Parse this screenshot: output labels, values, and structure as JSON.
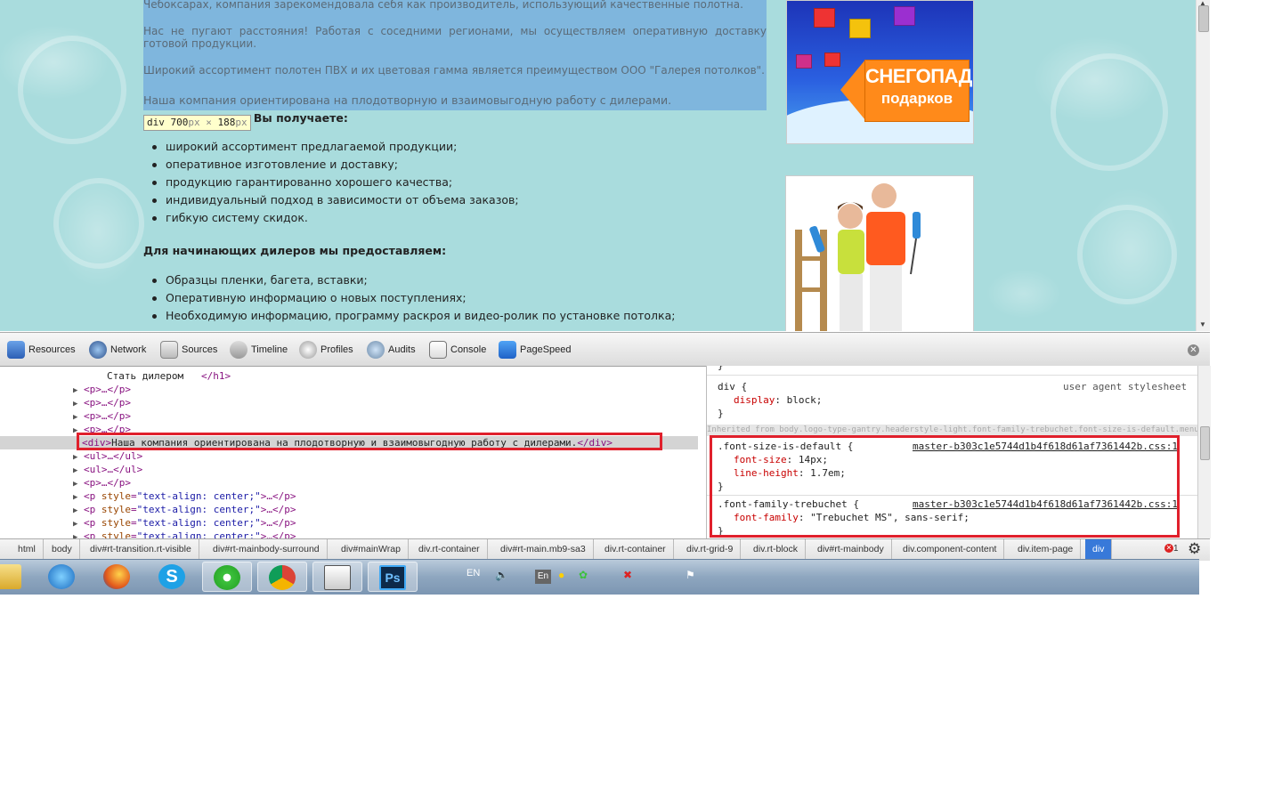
{
  "page": {
    "paragraphs": [
      "Чебоксарах, компания зарекомендовала себя как производитель, использующий качественные полотна.",
      "Нас не пугают расстояния! Работая с соседними регионами, мы осуществляем оперативную доставку готовой продукции.",
      "Широкий ассортимент полотен ПВХ и их цветовая гамма является преимуществом ООО \"Галерея потолков\".",
      "Наша компания ориентирована на плодотворную и взаимовыгодную работу с дилерами."
    ],
    "dims_tooltip": {
      "tag": "div",
      "width": "700",
      "height": "188",
      "unit": "px",
      "times": "×"
    },
    "partner_heading_visible": "ом, Вы получаете:",
    "benefits": [
      "широкий ассортимент предлагаемой продукции;",
      "оперативное изготовление и доставку;",
      "продукцию гарантированно хорошего качества;",
      "индивидуальный подход в зависимости от объема заказов;",
      "гибкую систему скидок."
    ],
    "dealers_heading": "Для начинающих дилеров мы предоставляем:",
    "dealer_items": [
      "Образцы пленки, багета, вставки;",
      "Оперативную информацию о новых поступлениях;",
      "Необходимую информацию, программу раскроя и видео-ролик  по установке потолка;"
    ],
    "banner": {
      "line1": "СНЕГОПАД",
      "line2": "подарков"
    }
  },
  "devtools": {
    "tabs": [
      "Resources",
      "Network",
      "Sources",
      "Timeline",
      "Profiles",
      "Audits",
      "Console",
      "PageSpeed"
    ],
    "elements": {
      "h1_text": "Стать дилером",
      "h1_close": "</h1>",
      "p_collapsed": "<p>…</p>",
      "selected_open": "<div>",
      "selected_text": "Наша компания ориентирована на плодотворную и взаимовыгодную работу с дилерами.",
      "selected_close": "</div>",
      "ul_collapsed": "<ul>…</ul>",
      "p_style_tag": "<p",
      "p_style_attr": "style",
      "p_style_value": "\"text-align: center;\"",
      "p_style_end": ">…</p>"
    },
    "styles": {
      "rule1_selector": "div {",
      "rule1_origin": "user agent stylesheet",
      "rule1_prop": "display",
      "rule1_value": "block;",
      "inherited_text": "Inherited from body.logo-type-gantry.headerstyle-light.font-family-trebuchet.font-size-is-default.menu-type",
      "rule2_selector": ".font-size-is-default {",
      "rule2_source": "master-b303c1e5744d1b4f618d61af7361442b.css:1",
      "rule2_prop1": "font-size",
      "rule2_value1": "14px;",
      "rule2_prop2": "line-height",
      "rule2_value2": "1.7em;",
      "rule3_selector": ".font-family-trebuchet {",
      "rule3_source": "master-b303c1e5744d1b4f618d61af7361442b.css:1",
      "rule3_prop": "font-family",
      "rule3_value": "\"Trebuchet MS\", sans-serif;",
      "close_brace": "}"
    },
    "breadcrumbs": [
      "html",
      "body",
      "div#rt-transition.rt-visible",
      "div#rt-mainbody-surround",
      "div#mainWrap",
      "div.rt-container",
      "div#rt-main.mb9-sa3",
      "div.rt-container",
      "div.rt-grid-9",
      "div.rt-block",
      "div#rt-mainbody",
      "div.component-content",
      "div.item-page",
      "div"
    ],
    "error_count": "1"
  },
  "taskbar": {
    "lang": "EN",
    "tray_lang": "En"
  },
  "colors": {
    "selection_box": "#e0202c",
    "active_crumb": "#3879d9",
    "highlight": "#6fa8dc"
  }
}
